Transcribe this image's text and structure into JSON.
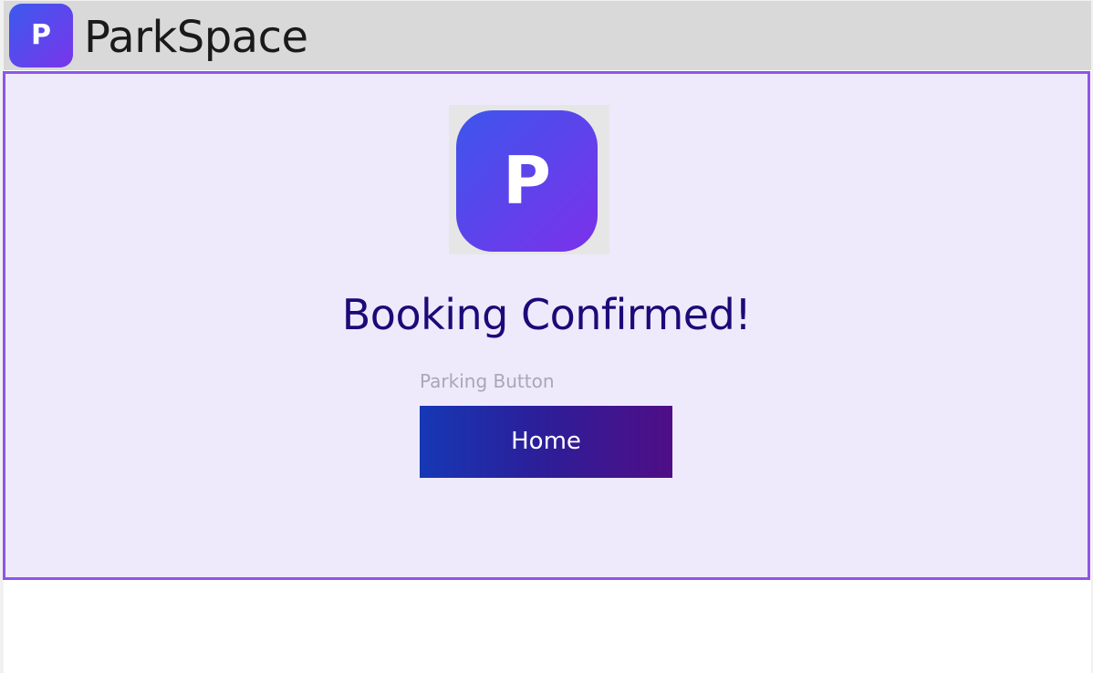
{
  "header": {
    "app_icon_letter": "P",
    "app_name": "ParkSpace"
  },
  "main": {
    "logo_letter": "P",
    "title": "Booking Confirmed!",
    "button_caption": "Parking Button",
    "home_button_label": "Home"
  },
  "colors": {
    "header_bg": "#d9d9d9",
    "panel_bg": "#eeeafc",
    "panel_border": "#8d55ec",
    "title_text": "#1c0a78",
    "brand_gradient_start": "#3d56ec",
    "brand_gradient_end": "#7c31ea",
    "button_gradient_start": "#1638b5",
    "button_gradient_end": "#4f0e86"
  },
  "icons": {
    "app_icon": "parking-logo-icon",
    "main_logo": "parking-logo-icon"
  }
}
